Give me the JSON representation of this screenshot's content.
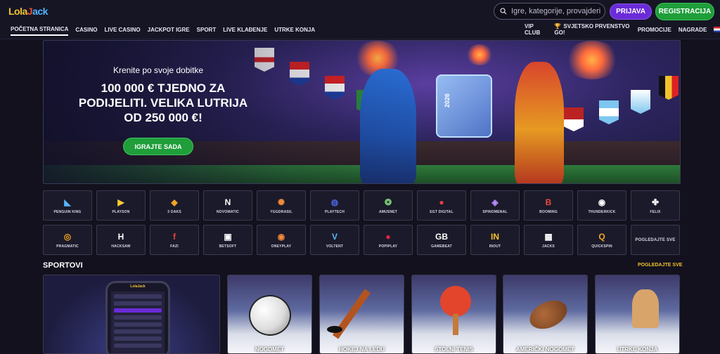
{
  "header": {
    "logo_text": {
      "a": "Lola",
      "b": "J",
      "c": "ack"
    },
    "search_placeholder": "Igre, kategorije, provajderi",
    "login_label": "PRIJAVA",
    "register_label": "REGISTRACIJA"
  },
  "nav": {
    "left": [
      "POČETNA STRANICA",
      "CASINO",
      "LIVE CASINO",
      "JACKPOT IGRE",
      "SPORT",
      "LIVE KLAĐENJE",
      "UTRKE KONJA"
    ],
    "right": [
      "VIP CLUB",
      "SVJETSKO PRVENSTVO GO!",
      "PROMOCIJE",
      "NAGRADE"
    ]
  },
  "hero": {
    "subtitle": "Krenite po svoje dobitke",
    "title_lines": [
      "100 000 € TJEDNO ZA",
      "PODIJELITI. VELIKA LUTRIJA",
      "OD 250 000 €!"
    ],
    "cta": "IGRAJTE SADA",
    "trophy_text": "2026"
  },
  "providers": [
    {
      "name": "PENGUIN KING",
      "icon": "◣",
      "color": "#58b6ff"
    },
    {
      "name": "PLAYSON",
      "icon": "▶",
      "color": "#ffcc33"
    },
    {
      "name": "3 OAKS",
      "icon": "◆",
      "color": "#f2a422"
    },
    {
      "name": "NOVOMATIC",
      "icon": "N",
      "color": "#ffffff"
    },
    {
      "name": "YGGDRASIL",
      "icon": "✺",
      "color": "#f28a3a"
    },
    {
      "name": "PLAYTECH",
      "icon": "◍",
      "color": "#4a63d8"
    },
    {
      "name": "AMUSNET",
      "icon": "❂",
      "color": "#7fd37a"
    },
    {
      "name": "EGT DIGITAL",
      "icon": "●",
      "color": "#e84040"
    },
    {
      "name": "SPINOMENAL",
      "icon": "◈",
      "color": "#b68cff"
    },
    {
      "name": "BOOMING",
      "icon": "B",
      "color": "#f04a3a"
    },
    {
      "name": "THUNDERKICK",
      "icon": "◉",
      "color": "#ffffff"
    },
    {
      "name": "FELIX",
      "icon": "✤",
      "color": "#ffffff"
    },
    {
      "name": "PRAGMATIC",
      "icon": "◎",
      "color": "#f2a422"
    },
    {
      "name": "HACKSAW",
      "icon": "H",
      "color": "#ffffff"
    },
    {
      "name": "FAZI",
      "icon": "f",
      "color": "#e84040"
    },
    {
      "name": "BETSOFT",
      "icon": "▣",
      "color": "#ffffff"
    },
    {
      "name": "ONEYPLAY",
      "icon": "◉",
      "color": "#f28a3a"
    },
    {
      "name": "VOLTENT",
      "icon": "V",
      "color": "#58b6ff"
    },
    {
      "name": "POPIPLAY",
      "icon": "●",
      "color": "#e8243a"
    },
    {
      "name": "GAMEBEAT",
      "icon": "GB",
      "color": "#ffffff"
    },
    {
      "name": "INOUT",
      "icon": "IN",
      "color": "#f2c230"
    },
    {
      "name": "JACKS",
      "icon": "▦",
      "color": "#ffffff"
    },
    {
      "name": "QUICKSPIN",
      "icon": "Q",
      "color": "#f2a422"
    },
    {
      "name": "POGLEDAJTE SVE",
      "icon": "",
      "color": "#ffffff"
    }
  ],
  "sports_section": {
    "title": "SPORTOVI",
    "view_all": "POGLEDAJTE SVE",
    "phone_logo": "LolaJack",
    "items": [
      "NOGOMET",
      "HOKEJ NA LEDU",
      "STOLNI TENIS",
      "AMERIČKI NOGOMET",
      "UTRKE KONJA"
    ]
  }
}
